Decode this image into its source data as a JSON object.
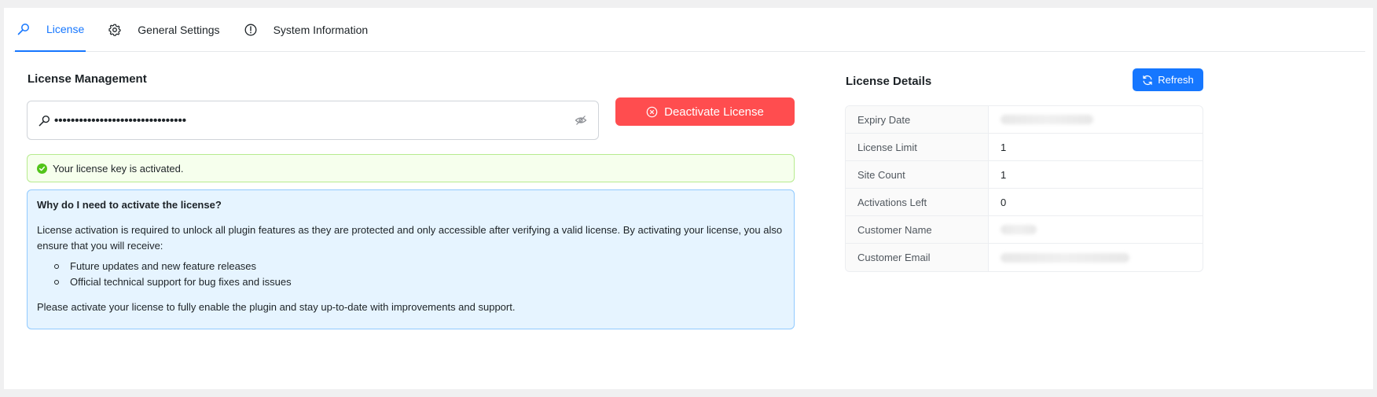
{
  "tabs": [
    {
      "label": "License",
      "icon": "key-icon",
      "active": true
    },
    {
      "label": "General Settings",
      "icon": "gear-icon",
      "active": false
    },
    {
      "label": "System Information",
      "icon": "info-icon",
      "active": false
    }
  ],
  "license_management": {
    "title": "License Management",
    "key_value": "••••••••••••••••••••••••••••••••",
    "deactivate_label": "Deactivate License",
    "success_message": "Your license key is activated.",
    "info": {
      "title": "Why do I need to activate the license?",
      "paragraph": "License activation is required to unlock all plugin features as they are protected and only accessible after verifying a valid license. By activating your license, you also ensure that you will receive:",
      "bullets": [
        "Future updates and new feature releases",
        "Official technical support for bug fixes and issues"
      ],
      "footer": "Please activate your license to fully enable the plugin and stay up-to-date with improvements and support."
    }
  },
  "license_details": {
    "title": "License Details",
    "refresh_label": "Refresh",
    "rows": [
      {
        "label": "Expiry Date",
        "value": "",
        "blurred": true
      },
      {
        "label": "License Limit",
        "value": "1",
        "blurred": false
      },
      {
        "label": "Site Count",
        "value": "1",
        "blurred": false
      },
      {
        "label": "Activations Left",
        "value": "0",
        "blurred": false
      },
      {
        "label": "Customer Name",
        "value": "",
        "blurred": true
      },
      {
        "label": "Customer Email",
        "value": "",
        "blurred": true
      }
    ]
  },
  "colors": {
    "primary": "#1677ff",
    "danger": "#ff4d4f",
    "success": "#52c41a"
  }
}
